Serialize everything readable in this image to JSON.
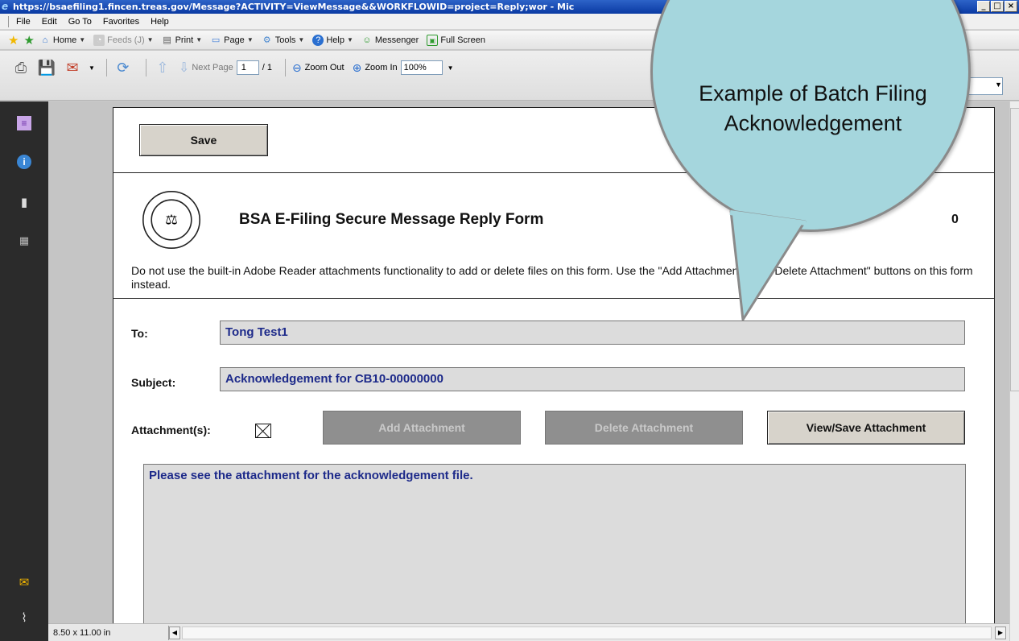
{
  "window": {
    "title": "https://bsaefiling1.fincen.treas.gov/Message?ACTIVITY=ViewMessage&&WORKFLOWID=project=Reply;wor - Mic",
    "min_label": "_",
    "max_label": "□",
    "close_label": "×"
  },
  "menu": {
    "items": [
      "File",
      "Edit",
      "Go To",
      "Favorites",
      "Help"
    ]
  },
  "commands": {
    "home": "Home",
    "feeds": "Feeds (J)",
    "print": "Print",
    "page": "Page",
    "tools": "Tools",
    "help": "Help",
    "messenger": "Messenger",
    "fullscreen": "Full Screen"
  },
  "pdf_toolbar": {
    "next_page": "Next Page",
    "current_page": "1",
    "total_pages": "/ 1",
    "zoom_out": "Zoom Out",
    "zoom_in": "Zoom In",
    "zoom_level": "100%"
  },
  "form": {
    "save_label": "Save",
    "title": "BSA E-Filing Secure Message Reply Form",
    "title_trail": "0",
    "notice": "Do not use the built-in Adobe Reader attachments functionality to add or delete files on this form. Use the \"Add Attachment\" and \"Delete Attachment\" buttons on this form instead.",
    "to_label": "To:",
    "to_value": "Tong Test1",
    "subject_label": "Subject:",
    "subject_value": "Acknowledgement for CB10-00000000",
    "attachments_label": "Attachment(s):",
    "add_attachment": "Add Attachment",
    "delete_attachment": "Delete Attachment",
    "view_save_attachment": "View/Save Attachment",
    "message": "Please see the attachment for the acknowledgement file."
  },
  "status": {
    "page_size": "8.50 x 11.00 in"
  },
  "callout": {
    "text": "Example of Batch Filing Acknowledgement",
    "fill_color": "#a5d6dd"
  }
}
